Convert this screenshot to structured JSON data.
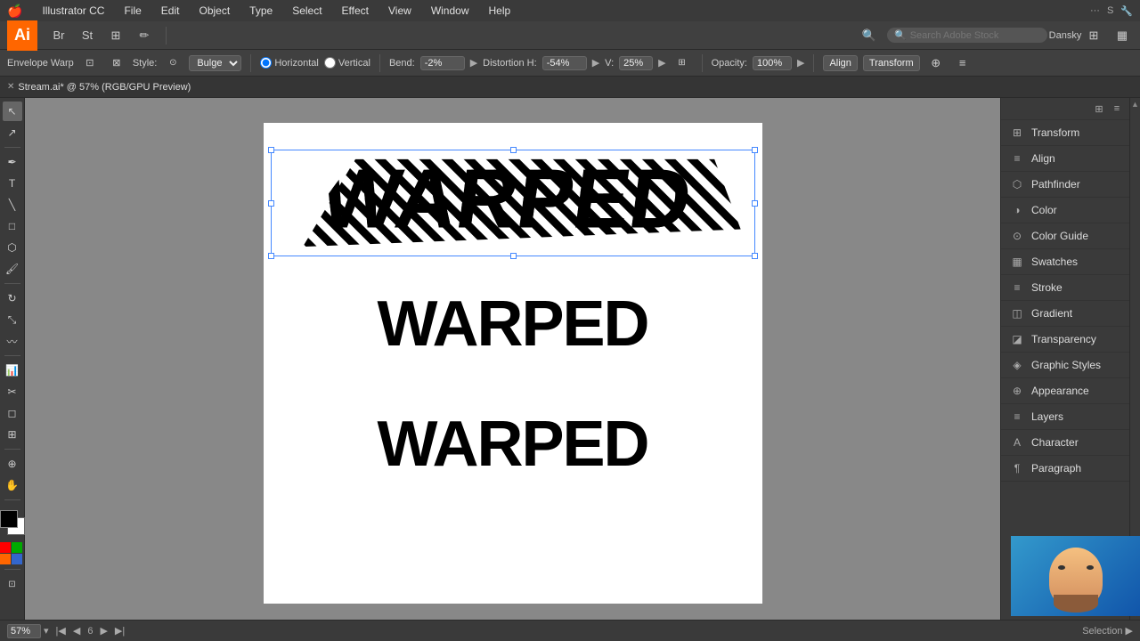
{
  "menubar": {
    "apple": "🍎",
    "app_name": "Illustrator CC",
    "menus": [
      "File",
      "Edit",
      "Object",
      "Type",
      "Select",
      "Effect",
      "View",
      "Window",
      "Help"
    ]
  },
  "toolbar_top": {
    "logo": "Ai",
    "icons": [
      "bridge_icon",
      "stock_icon",
      "layout_icon",
      "pencil_icon"
    ],
    "search_placeholder": "Search Adobe Stock",
    "user": "Dansky"
  },
  "toolbar_context": {
    "label": "Envelope Warp",
    "style_label": "Style:",
    "style_value": "Bulge",
    "horizontal_label": "Horizontal",
    "vertical_label": "Vertical",
    "bend_label": "Bend:",
    "bend_value": "-2%",
    "distortion_label": "Distortion H:",
    "distortion_h_value": "-54%",
    "distortion_v_label": "V:",
    "distortion_v_value": "25%",
    "opacity_label": "Opacity:",
    "opacity_value": "100%",
    "align_label": "Align",
    "transform_label": "Transform"
  },
  "tab": {
    "title": "Stream.ai* @ 57% (RGB/GPU Preview)"
  },
  "canvas": {
    "warped_text": "WARPED",
    "main_text1": "WARPED",
    "main_text2": "WARPED"
  },
  "right_panel": {
    "items": [
      {
        "id": "transform",
        "label": "Transform",
        "icon": "⊞"
      },
      {
        "id": "align",
        "label": "Align",
        "icon": "≡"
      },
      {
        "id": "pathfinder",
        "label": "Pathfinder",
        "icon": "⬡"
      },
      {
        "id": "color",
        "label": "Color",
        "icon": "◑"
      },
      {
        "id": "color-guide",
        "label": "Color Guide",
        "icon": "⊙"
      },
      {
        "id": "swatches",
        "label": "Swatches",
        "icon": "▦"
      },
      {
        "id": "stroke",
        "label": "Stroke",
        "icon": "≡"
      },
      {
        "id": "gradient",
        "label": "Gradient",
        "icon": "◫"
      },
      {
        "id": "transparency",
        "label": "Transparency",
        "icon": "◪"
      },
      {
        "id": "graphic-styles",
        "label": "Graphic Styles",
        "icon": "◈"
      },
      {
        "id": "appearance",
        "label": "Appearance",
        "icon": "⊕"
      },
      {
        "id": "layers",
        "label": "Layers",
        "icon": "≡"
      },
      {
        "id": "character",
        "label": "Character",
        "icon": "A"
      },
      {
        "id": "paragraph",
        "label": "Paragraph",
        "icon": "¶"
      }
    ]
  },
  "status_bar": {
    "zoom": "57%",
    "page": "6",
    "tool": "Selection",
    "arrow_label": "▶"
  },
  "color_swatches": {
    "fg": "#000000",
    "bg": "#ffffff",
    "swatches": [
      "#ff0000",
      "#00aa00",
      "#0000ff",
      "#ffff00",
      "#ff8800",
      "#aa00aa"
    ]
  }
}
